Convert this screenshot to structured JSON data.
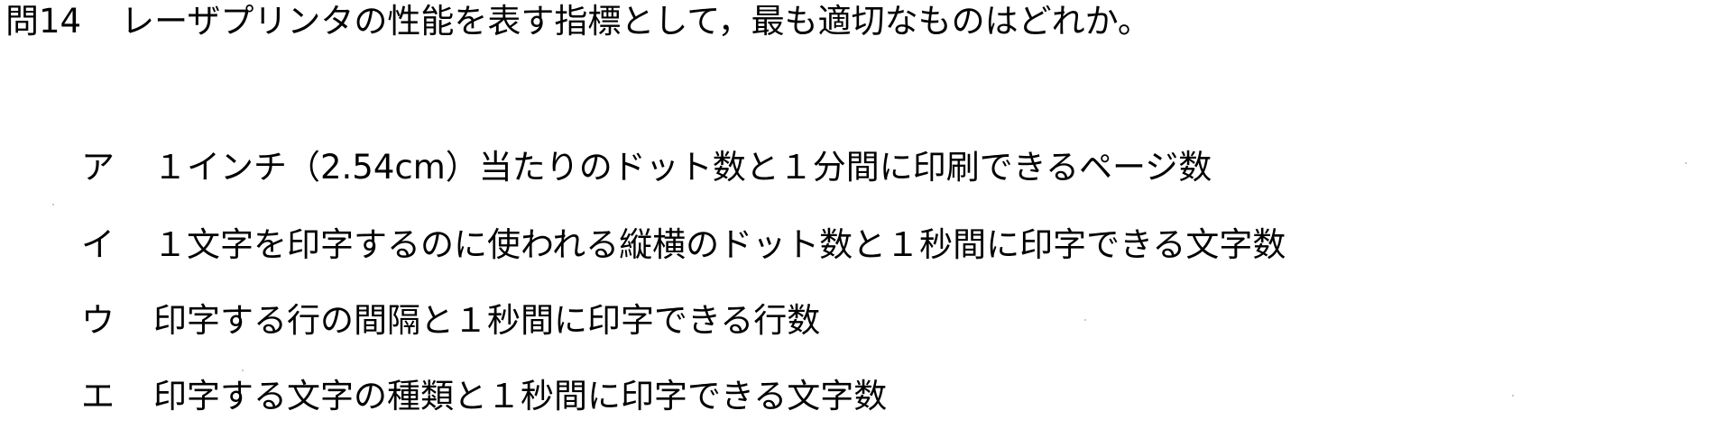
{
  "question": {
    "number": "問14",
    "text": "レーザプリンタの性能を表す指標として，最も適切なものはどれか。"
  },
  "choices": [
    {
      "label": "ア",
      "text": "１インチ（2.54cm）当たりのドット数と１分間に印刷できるページ数"
    },
    {
      "label": "イ",
      "text": "１文字を印字するのに使われる縦横のドット数と１秒間に印字できる文字数"
    },
    {
      "label": "ウ",
      "text": "印字する行の間隔と１秒間に印字できる行数"
    },
    {
      "label": "エ",
      "text": "印字する文字の種類と１秒間に印字できる文字数"
    }
  ]
}
